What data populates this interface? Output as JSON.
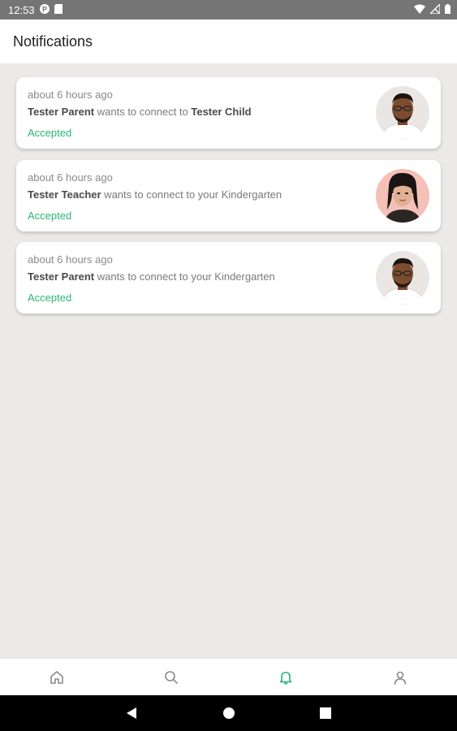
{
  "status_bar": {
    "time": "12:53",
    "icons": [
      "pinterest-icon",
      "sd-card-icon",
      "wifi-icon",
      "no-signal-icon",
      "battery-icon"
    ],
    "background": "#757575"
  },
  "app_bar": {
    "title": "Notifications"
  },
  "notifications": [
    {
      "time": "about 6 hours ago",
      "actor": "Tester Parent",
      "action": " wants to connect to ",
      "target": "Tester Child",
      "target_bold": true,
      "status": "Accepted",
      "avatar": "male-avatar"
    },
    {
      "time": "about 6 hours ago",
      "actor": "Tester Teacher",
      "action": " wants to connect to your Kindergarten",
      "target": "",
      "target_bold": false,
      "status": "Accepted",
      "avatar": "female-avatar"
    },
    {
      "time": "about 6 hours ago",
      "actor": "Tester Parent",
      "action": " wants to connect to your Kindergarten",
      "target": "",
      "target_bold": false,
      "status": "Accepted",
      "avatar": "male-avatar"
    }
  ],
  "bottom_nav": {
    "items": [
      {
        "icon": "home-icon",
        "active": false
      },
      {
        "icon": "search-icon",
        "active": false
      },
      {
        "icon": "bell-icon",
        "active": true
      },
      {
        "icon": "user-icon",
        "active": false
      }
    ]
  },
  "system_nav": {
    "icons": [
      "back-icon",
      "home-circle-icon",
      "recents-icon"
    ]
  },
  "colors": {
    "accent": "#22b573",
    "accepted": "#2bb673",
    "inactive_icon": "#8a8a8a"
  }
}
